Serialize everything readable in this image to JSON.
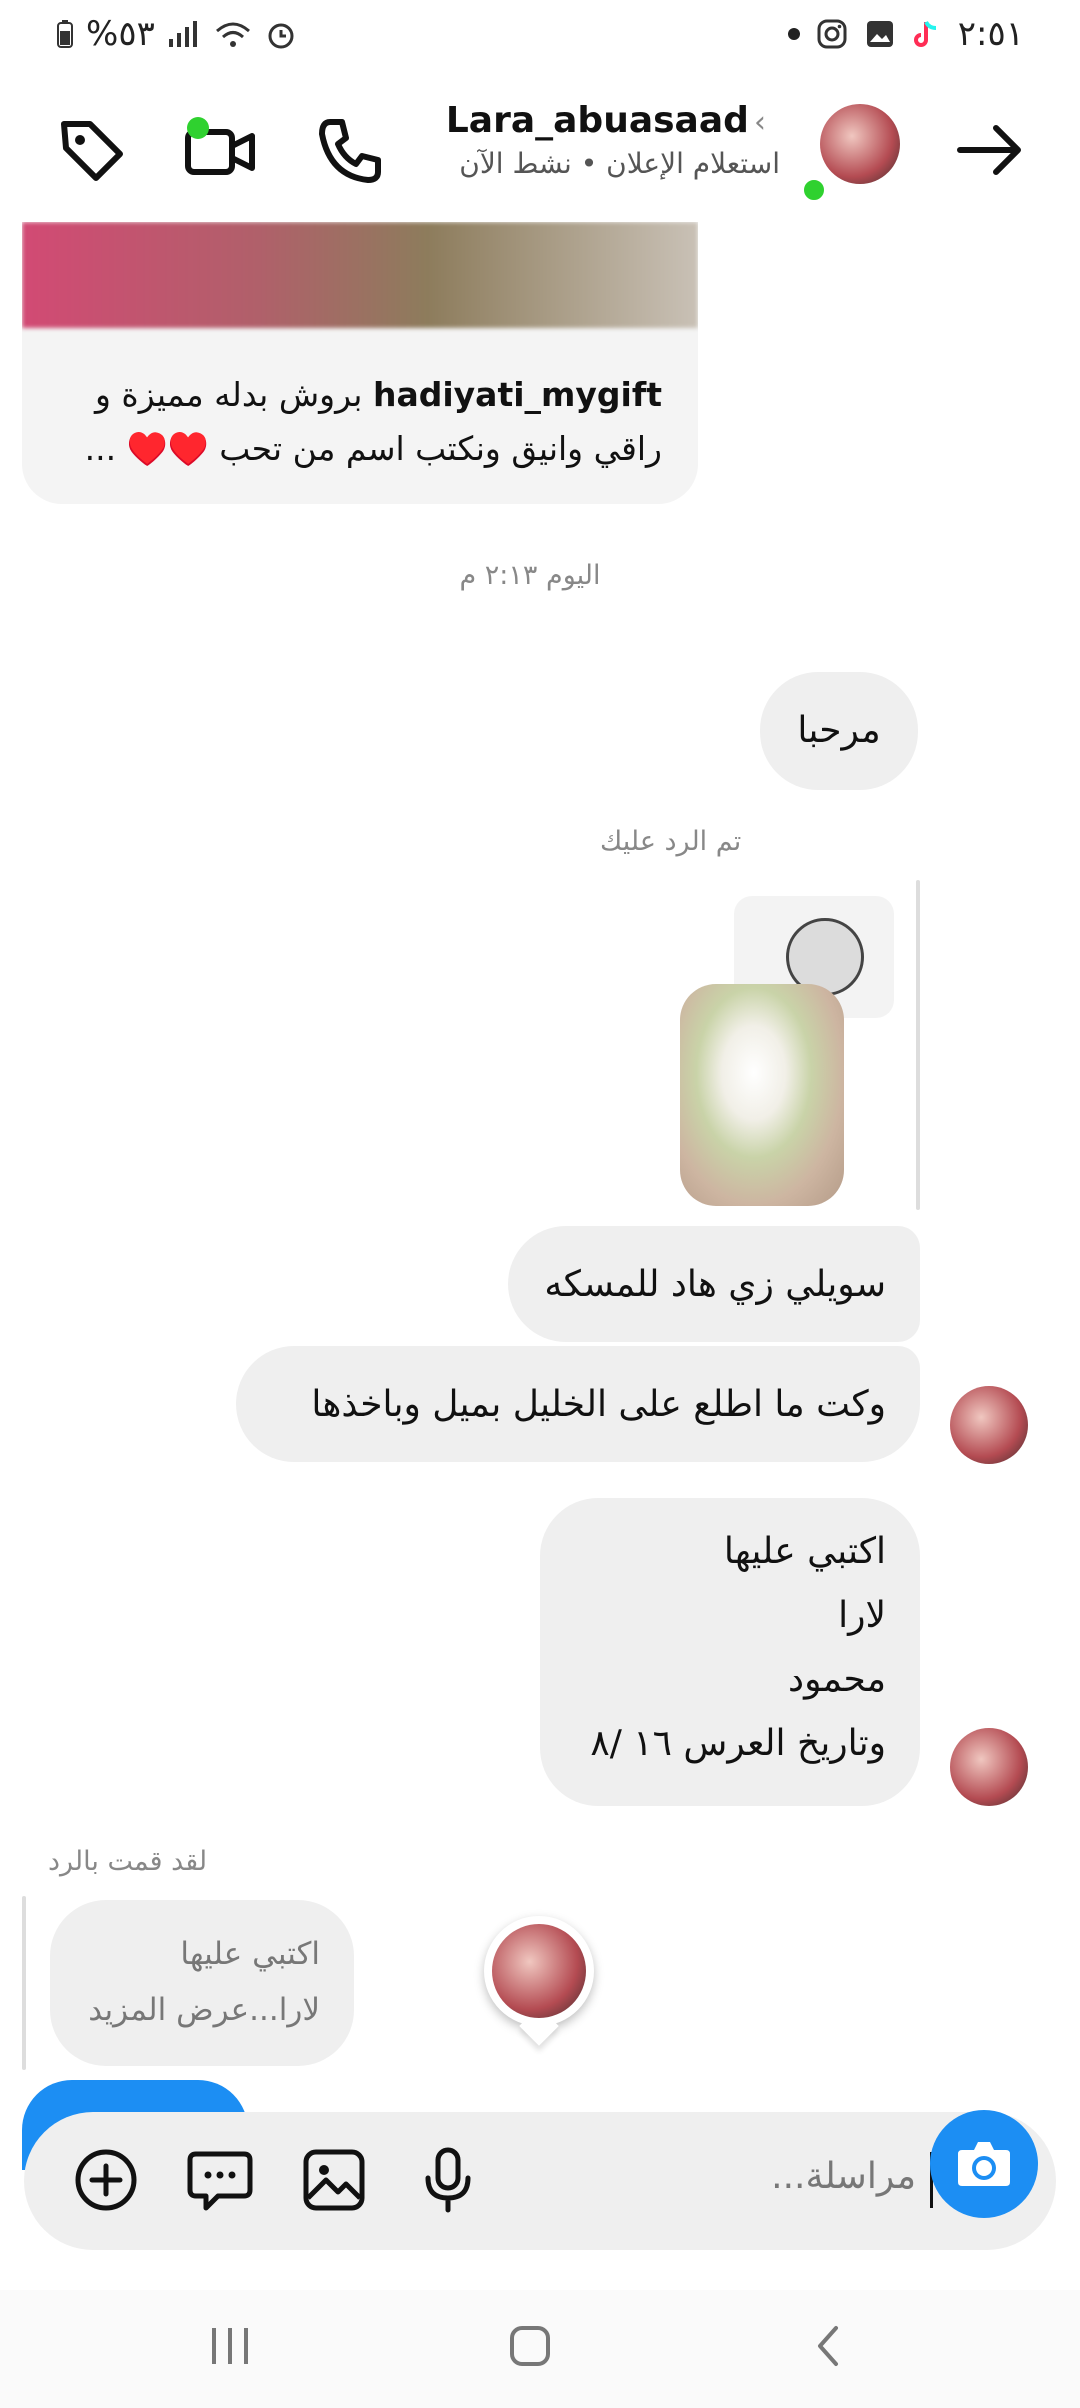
{
  "statusbar": {
    "time": "٢:٥١",
    "battery_text": "%٥٣",
    "icons": [
      "tiktok-icon",
      "gallery-icon",
      "instagram-icon",
      "dot"
    ]
  },
  "header": {
    "username": "Lara_abuasaad",
    "subtitle": "استعلام الإعلان • نشط الآن",
    "chevron": "›"
  },
  "post_card": {
    "account": "hadiyati_mygift",
    "caption": "بروش بدله مميزة و راقي وانيق ونكتب اسم من تحب ♥️♥️ ..."
  },
  "timestamp": "اليوم ٢:١٣ م",
  "messages": {
    "msg1": "مرحبا",
    "reply_label": "تم الرد عليك",
    "msg2": "سويلي زي هاد للمسكه",
    "msg3": "وكت ما اطلع على الخليل بميل وباخذها",
    "msg4_lines": [
      "اكتبي عليها",
      "لارا",
      "محمود",
      "وتاريخ العرس ١٦ /٨"
    ]
  },
  "sent_reply": {
    "label": "لقد قمت بالرد",
    "line1": "اكتبي عليها",
    "line2": "لارا...عرض المزيد"
  },
  "composer": {
    "placeholder": "مراسلة..."
  },
  "colors": {
    "accent": "#1c8ef3",
    "online": "#2fd12f",
    "bubble": "#efefef"
  }
}
